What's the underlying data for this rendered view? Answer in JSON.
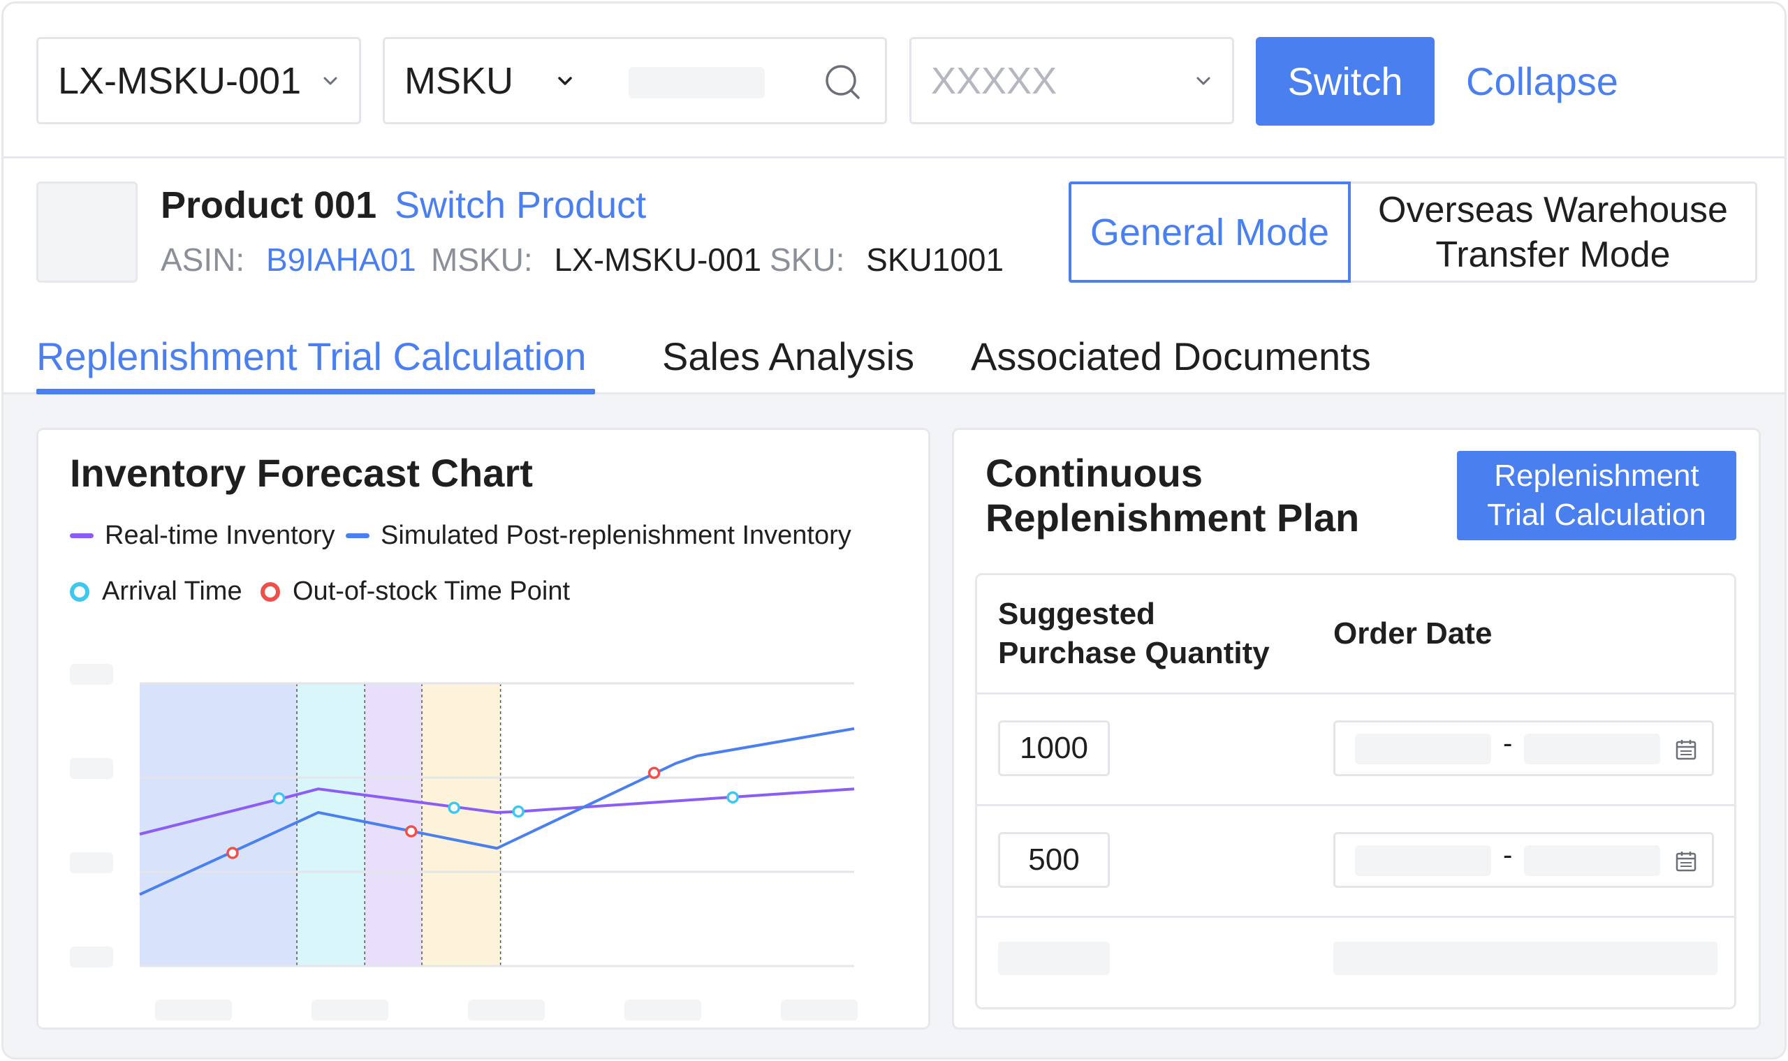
{
  "toolbar": {
    "store_select": "LX-MSKU-001",
    "field_select": "MSKU",
    "search_placeholder": "",
    "filter_placeholder": "XXXXX",
    "switch_label": "Switch",
    "collapse_label": "Collapse"
  },
  "product": {
    "name": "Product 001",
    "switch_label": "Switch Product",
    "asin_label": "ASIN:",
    "asin_value": "B9IAHA01",
    "msku_label": "MSKU:",
    "msku_value": "LX-MSKU-001",
    "sku_label": "SKU:",
    "sku_value": "SKU1001"
  },
  "modes": {
    "general": "General Mode",
    "overseas_line1": "Overseas Warehouse",
    "overseas_line2": "Transfer Mode"
  },
  "tabs": [
    {
      "label": "Replenishment Trial Calculation",
      "active": true
    },
    {
      "label": "Sales Analysis",
      "active": false
    },
    {
      "label": "Associated Documents",
      "active": false
    }
  ],
  "forecast": {
    "title": "Inventory Forecast Chart",
    "legend": {
      "realtime": "Real-time Inventory",
      "simulated": "Simulated Post-replenishment Inventory",
      "arrival": "Arrival Time",
      "stockout": "Out-of-stock Time Point"
    },
    "colors": {
      "realtime": "#8b5cf6",
      "simulated": "#4a7ff0",
      "arrival": "#3ec8f0",
      "stockout": "#f0504a"
    }
  },
  "chart_data": {
    "type": "line",
    "title": "Inventory Forecast Chart",
    "xlabel": "",
    "ylabel": "",
    "x": [
      0,
      1,
      2,
      3,
      4,
      5,
      6,
      7,
      8,
      9,
      10
    ],
    "ylim": [
      0,
      3
    ],
    "grid": true,
    "legend": "top-left",
    "series": [
      {
        "name": "Real-time Inventory",
        "x": [
          0,
          2.0,
          2.5,
          4.5,
          5.0,
          5.3,
          10
        ],
        "values": [
          1.4,
          1.78,
          1.88,
          1.68,
          1.63,
          1.64,
          1.88
        ]
      },
      {
        "name": "Simulated Post-replenishment Inventory",
        "x": [
          0,
          2.5,
          5.0,
          7.5,
          7.8,
          10
        ],
        "values": [
          0.76,
          1.63,
          1.25,
          2.15,
          2.23,
          2.52
        ]
      }
    ],
    "markers": {
      "arrival": [
        [
          1.95,
          1.78
        ],
        [
          4.4,
          1.68
        ],
        [
          5.3,
          1.64
        ],
        [
          8.3,
          1.79
        ]
      ],
      "stockout": [
        [
          1.3,
          1.2
        ],
        [
          3.8,
          1.43
        ],
        [
          7.2,
          2.05
        ]
      ]
    },
    "bands": [
      {
        "x0": 0,
        "x1": 2.2,
        "color": "#d9e2fb"
      },
      {
        "x0": 2.2,
        "x1": 3.15,
        "color": "#d9f6fb"
      },
      {
        "x0": 3.15,
        "x1": 3.95,
        "color": "#e8dffb"
      },
      {
        "x0": 3.95,
        "x1": 5.05,
        "color": "#fdf3da"
      }
    ]
  },
  "plan": {
    "title_line1": "Continuous",
    "title_line2": "Replenishment Plan",
    "trial_button_line1": "Replenishment",
    "trial_button_line2": "Trial Calculation",
    "col_qty_line1": "Suggested",
    "col_qty_line2": "Purchase Quantity",
    "col_date": "Order Date",
    "rows": [
      {
        "qty": "1000",
        "date_sep": "-"
      },
      {
        "qty": "500",
        "date_sep": "-"
      }
    ]
  }
}
